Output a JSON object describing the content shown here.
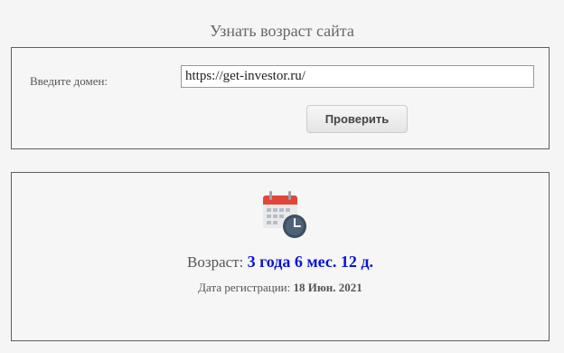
{
  "page": {
    "title": "Узнать возраст сайта"
  },
  "form": {
    "domain_label": "Введите домен:",
    "domain_value": "https://get-investor.ru/",
    "check_button": "Проверить"
  },
  "result": {
    "calendar_icon": "calendar-clock-icon",
    "age_label": "Возраст:",
    "age_value": "3 года 6 мес. 12 д.",
    "registration_label": "Дата регистрации:",
    "registration_date": "18 Июн. 2021",
    "age_color": "#0c14d6"
  },
  "colors": {
    "calendar_header": "#e2463b",
    "clock_face": "#3c4e63"
  }
}
